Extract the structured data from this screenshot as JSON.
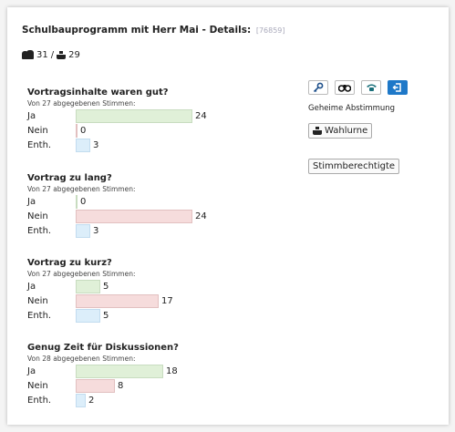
{
  "header": {
    "title": "Schulbauprogramm mit Herr Mai - Details:",
    "record_id": "[76859]"
  },
  "counts": {
    "people_icon": "people-icon",
    "attendees": "31",
    "separator": "/",
    "ballot_icon": "ballot-box-icon",
    "votes": "29"
  },
  "labels": {
    "ja": "Ja",
    "nein": "Nein",
    "enth": "Enth."
  },
  "questions": [
    {
      "title": "Vortragsinhalte waren gut?",
      "subtitle": "Von 27 abgegebenen Stimmen:",
      "ja": "24",
      "nein": "0",
      "enth": "3"
    },
    {
      "title": "Vortrag zu lang?",
      "subtitle": "Von 27 abgegebenen Stimmen:",
      "ja": "0",
      "nein": "24",
      "enth": "3"
    },
    {
      "title": "Vortrag zu kurz?",
      "subtitle": "Von 27 abgegebenen Stimmen:",
      "ja": "5",
      "nein": "17",
      "enth": "5"
    },
    {
      "title": "Genug Zeit für Diskussionen?",
      "subtitle": "Von 28 abgegebenen Stimmen:",
      "ja": "18",
      "nein": "8",
      "enth": "2"
    }
  ],
  "side": {
    "icons": [
      "key-icon",
      "binoculars-icon",
      "phone-icon",
      "logout-icon"
    ],
    "secret_label": "Geheime Abstimmung",
    "urn_button": "Wahlurne",
    "eligible_button": "Stimmberechtigte"
  },
  "colors": {
    "ja": "#e0f0d8",
    "nein": "#f6dcdc",
    "enth": "#dceefa",
    "accent": "#1e78c8",
    "record_id": "#aab"
  }
}
